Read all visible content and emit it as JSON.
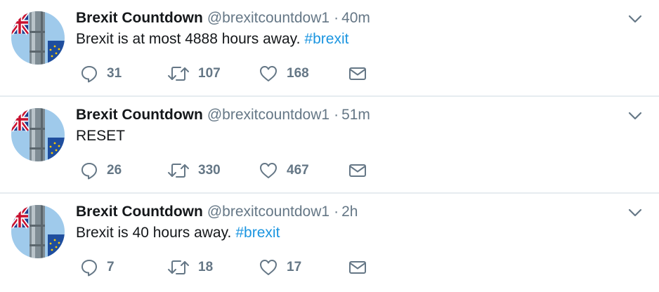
{
  "timeline": {
    "tweets": [
      {
        "name": "Brexit Countdown",
        "handle": "@brexitcountdow1",
        "separator": "·",
        "time": "40m",
        "text": "Brexit is at most 4888 hours away.",
        "hashtag": "#brexit",
        "replies": "31",
        "retweets": "107",
        "likes": "168"
      },
      {
        "name": "Brexit Countdown",
        "handle": "@brexitcountdow1",
        "separator": "·",
        "time": "51m",
        "text": "RESET",
        "hashtag": "",
        "replies": "26",
        "retweets": "330",
        "likes": "467"
      },
      {
        "name": "Brexit Countdown",
        "handle": "@brexitcountdow1",
        "separator": "·",
        "time": "2h",
        "text": "Brexit is 40 hours away.",
        "hashtag": "#brexit",
        "replies": "7",
        "retweets": "18",
        "likes": "17"
      }
    ]
  },
  "icons": {
    "reply": "speech-bubble-icon",
    "retweet": "retweet-arrows-icon",
    "like": "heart-icon",
    "message": "envelope-icon",
    "menu": "chevron-down-icon"
  },
  "colors": {
    "text": "#14171a",
    "secondary": "#657786",
    "link": "#1b95e0",
    "divider": "#e6ecf0",
    "avatar_sky": "#9fcaeb",
    "eu_blue": "#1f4e9e",
    "union_red": "#c8102e"
  }
}
